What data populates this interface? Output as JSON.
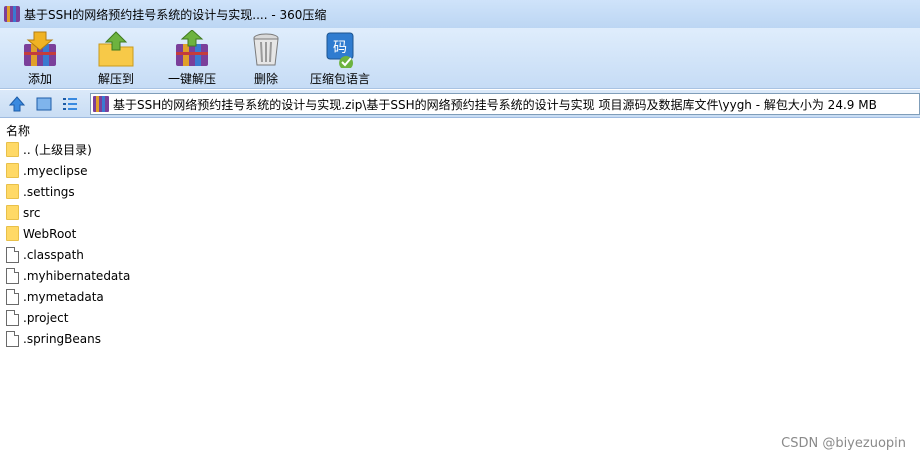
{
  "window": {
    "title": "基于SSH的网络预约挂号系统的设计与实现.... - 360压缩"
  },
  "toolbar": {
    "add_label": "添加",
    "extract_label": "解压到",
    "one_click_label": "一键解压",
    "delete_label": "删除",
    "language_label": "压缩包语言",
    "language_icon_char": "码"
  },
  "addressbar": {
    "path": "基于SSH的网络预约挂号系统的设计与实现.zip\\基于SSH的网络预约挂号系统的设计与实现 项目源码及数据库文件\\yygh - 解包大小为 24.9 MB"
  },
  "list": {
    "column_name": "名称",
    "items": [
      {
        "label": ".. (上级目录)",
        "kind": "folder"
      },
      {
        "label": ".myeclipse",
        "kind": "folder"
      },
      {
        "label": ".settings",
        "kind": "folder"
      },
      {
        "label": "src",
        "kind": "folder"
      },
      {
        "label": "WebRoot",
        "kind": "folder"
      },
      {
        "label": ".classpath",
        "kind": "file"
      },
      {
        "label": ".myhibernatedata",
        "kind": "file"
      },
      {
        "label": ".mymetadata",
        "kind": "file"
      },
      {
        "label": ".project",
        "kind": "file"
      },
      {
        "label": ".springBeans",
        "kind": "file"
      }
    ]
  },
  "watermark": "CSDN @biyezuopin",
  "icons": {
    "app": "winrar-books-icon",
    "add": "add-archive-icon",
    "extract": "extract-to-icon",
    "one_click": "one-click-extract-icon",
    "delete": "trash-can-icon",
    "language": "encoding-icon",
    "up": "up-arrow-icon",
    "view_large": "large-icons-view-icon",
    "view_details": "details-view-icon",
    "folder": "folder-icon",
    "file": "file-icon"
  },
  "colors": {
    "title_bg": "#cfe3fa",
    "toolbar_bg": "#dfedfc",
    "folder": "#ffd966",
    "accent_green": "#6db33f",
    "accent_blue": "#2f7cd0",
    "watermark": "#8a8a8a"
  }
}
